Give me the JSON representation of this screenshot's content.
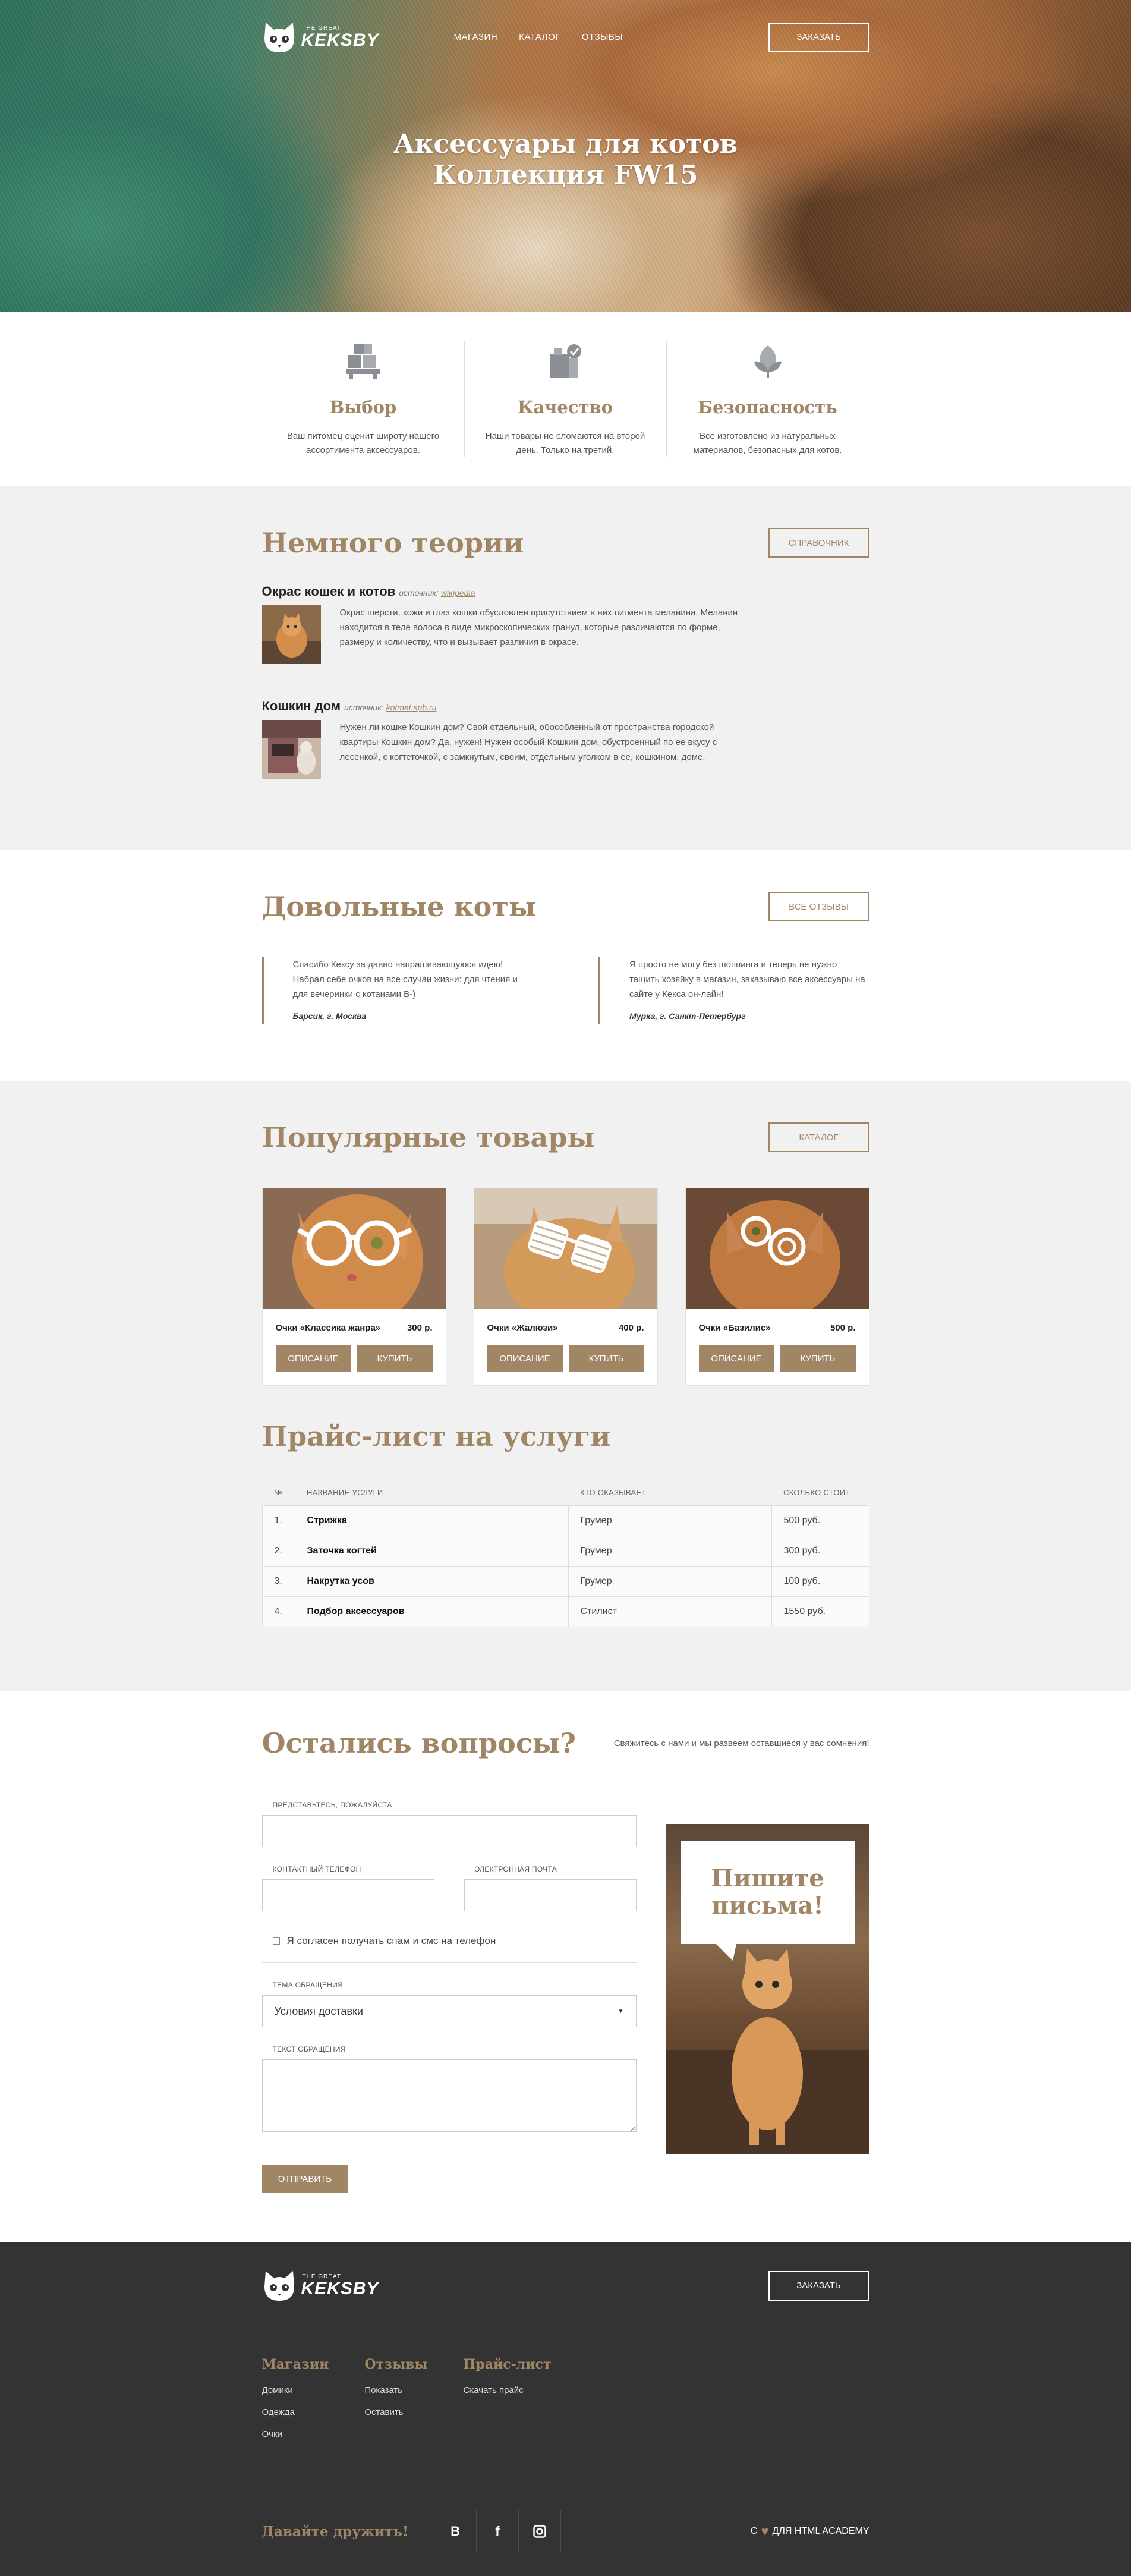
{
  "header": {
    "logo_small": "THE GREAT",
    "logo_big": "KEKSBY",
    "nav": [
      "МАГАЗИН",
      "КАТАЛОГ",
      "ОТЗЫВЫ"
    ],
    "order_button": "ЗАКАЗАТЬ"
  },
  "hero": {
    "title_line1": "Аксессуары для котов",
    "title_line2": "Коллекция FW15"
  },
  "features": [
    {
      "icon": "boxes-icon",
      "title": "Выбор",
      "text": "Ваш питомец оценит широту нашего ассортимента аксессуаров."
    },
    {
      "icon": "quality-check-icon",
      "title": "Качество",
      "text": "Наши товары не сломаются на второй день. Только на третий."
    },
    {
      "icon": "leaf-shield-icon",
      "title": "Безопасность",
      "text": "Все изготовлено из натуральных материалов, безопасных для котов."
    }
  ],
  "theory": {
    "title": "Немного теории",
    "button": "СПРАВОЧНИК",
    "source_label": "источник:",
    "articles": [
      {
        "title": "Окрас кошек и котов",
        "source": "wikipedia",
        "text": "Окрас шерсти, кожи и глаз кошки обусловлен присутствием в них пигмента меланина. Меланин находится в теле волоса в виде микроскопических гранул, которые различаются по форме, размеру и количеству, что и вызывает различия в окрасе."
      },
      {
        "title": "Кошкин дом",
        "source": "kotmet.spb.ru",
        "text": "Нужен ли кошке Кошкин дом? Свой отдельный, обособленный от пространства городской квартиры Кошкин дом? Да, нужен! Нужен особый Кошкин дом, обустроенный по ее вкусу с лесенкой, с когтеточкой, с замкнутым, своим, отдельным уголком в ее, кошкином, доме."
      }
    ]
  },
  "reviews": {
    "title": "Довольные коты",
    "button": "ВСЕ ОТЗЫВЫ",
    "items": [
      {
        "text": "Спасибо Кексу за давно напрашивающуюся идею! Набрал себе очков на все случаи жизни: для чтения и для вечеринки с котанами В-)",
        "author": "Барсик, г. Москва"
      },
      {
        "text": "Я просто не могу без шоппинга и теперь не нужно тащить хозяйку в магазин, заказываю все аксессуары на сайте у Кекса он-лайн!",
        "author": "Мурка, г. Санкт-Петербург"
      }
    ]
  },
  "products": {
    "title": "Популярные товары",
    "button": "КАТАЛОГ",
    "describe_label": "ОПИСАНИЕ",
    "buy_label": "КУПИТЬ",
    "items": [
      {
        "name": "Очки «Классика жанра»",
        "price": "300 р."
      },
      {
        "name": "Очки «Жалюзи»",
        "price": "400 р."
      },
      {
        "name": "Очки «Базилис»",
        "price": "500 р."
      }
    ]
  },
  "price_list": {
    "title": "Прайс-лист на услуги",
    "columns": [
      "№",
      "НАЗВАНИЕ УСЛУГИ",
      "КТО ОКАЗЫВАЕТ",
      "СКОЛЬКО СТОИТ"
    ],
    "rows": [
      [
        "1.",
        "Стрижка",
        "Грумер",
        "500 руб."
      ],
      [
        "2.",
        "Заточка когтей",
        "Грумер",
        "300 руб."
      ],
      [
        "3.",
        "Накрутка усов",
        "Грумер",
        "100 руб."
      ],
      [
        "4.",
        "Подбор аксессуаров",
        "Стилист",
        "1550 руб."
      ]
    ]
  },
  "contact": {
    "title": "Остались вопросы?",
    "note": "Свяжитесь с нами и мы развеем оставшиеся у вас сомнения!",
    "name_label": "ПРЕДСТАВЬТЕСЬ, ПОЖАЛУЙСТА",
    "phone_label": "КОНТАКТНЫЙ ТЕЛЕФОН",
    "email_label": "ЭЛЕКТРОННАЯ ПОЧТА",
    "spam_label": "Я согласен получать спам и смс на телефон",
    "topic_label": "ТЕМА ОБРАЩЕНИЯ",
    "topic_value": "Условия доставки",
    "message_label": "ТЕКСТ ОБРАЩЕНИЯ",
    "submit": "ОТПРАВИТЬ",
    "bubble_line1": "Пишите",
    "bubble_line2": "письма!"
  },
  "footer": {
    "logo_small": "THE GREAT",
    "logo_big": "KEKSBY",
    "order_button": "ЗАКАЗАТЬ",
    "columns": [
      {
        "title": "Магазин",
        "links": [
          "Домики",
          "Одежда",
          "Очки"
        ]
      },
      {
        "title": "Отзывы",
        "links": [
          "Показать",
          "Оставить"
        ]
      },
      {
        "title": "Прайс-лист",
        "links": [
          "Скачать прайс"
        ]
      }
    ],
    "friends": "Давайте дружить!",
    "socials": [
      "B",
      "f",
      "instagram-icon"
    ],
    "credit_prefix": "С",
    "credit_suffix": "ДЛЯ HTML ACADEMY"
  },
  "colors": {
    "accent": "#a08665",
    "gray_bg": "#f1f1f1",
    "footer_bg": "#333333"
  }
}
